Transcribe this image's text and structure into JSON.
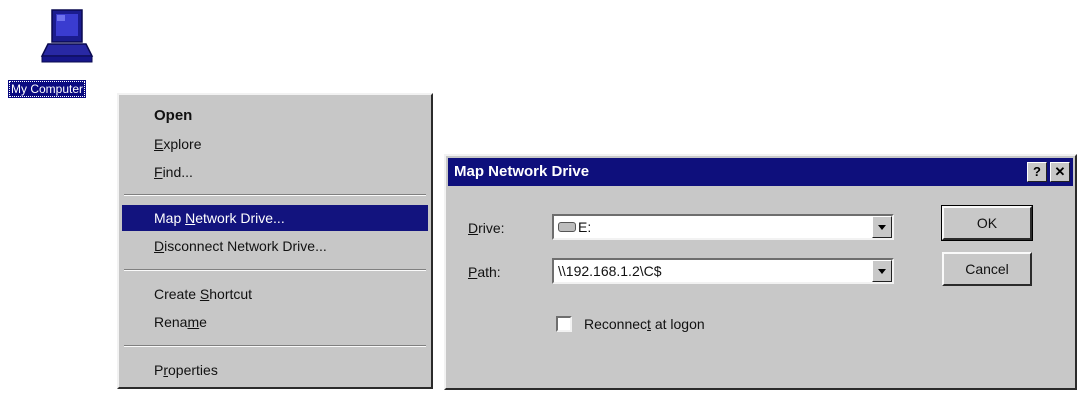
{
  "desktop": {
    "icon_label": "My Computer",
    "icon_name": "computer-icon"
  },
  "context_menu": {
    "items": [
      {
        "label": "Open",
        "bold": true
      },
      {
        "pre": "",
        "key": "E",
        "post": "xplore"
      },
      {
        "pre": "",
        "key": "F",
        "post": "ind..."
      },
      {
        "pre": "Map ",
        "key": "N",
        "post": "etwork Drive...",
        "selected": true
      },
      {
        "pre": "",
        "key": "D",
        "post": "isconnect Network Drive..."
      },
      {
        "pre": "Create ",
        "key": "S",
        "post": "hortcut"
      },
      {
        "pre": "Rena",
        "key": "m",
        "post": "e"
      },
      {
        "pre": "P",
        "key": "r",
        "post": "operties"
      }
    ]
  },
  "dialog": {
    "title": "Map Network Drive",
    "help_button": "?",
    "close_button": "✕",
    "drive": {
      "label_key": "D",
      "label_rest": "rive:",
      "value": "E:"
    },
    "path": {
      "label_key": "P",
      "label_rest": "ath:",
      "value": "\\\\192.168.1.2\\C$"
    },
    "reconnect": {
      "pre": "Reconnec",
      "key": "t",
      "post": " at logon",
      "checked": false
    },
    "ok_label": "OK",
    "cancel_label": "Cancel"
  },
  "colors": {
    "selection": "#12137e",
    "titlebar": "#0e0f7c",
    "face": "#c8c8c8"
  }
}
